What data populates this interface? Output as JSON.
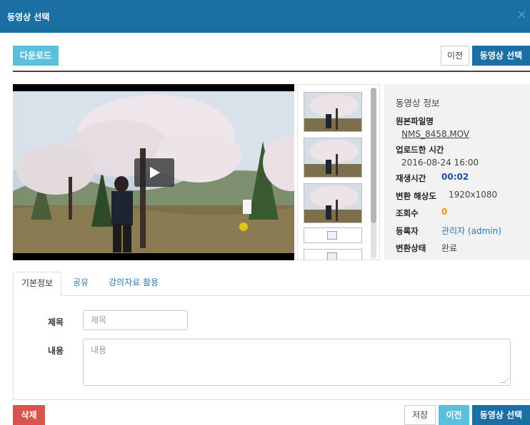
{
  "dialog": {
    "title": "동영상 선택",
    "close_symbol": "×"
  },
  "toolbar": {
    "download_label": "다운로드",
    "prev_label": "이전",
    "select_label": "동영상 선택"
  },
  "info": {
    "heading": "동영상 정보",
    "original_filename_label": "원본파일명",
    "original_filename": "NMS_8458.MOV",
    "upload_time_label": "업로드한 시간",
    "upload_time": "2016-08-24 16:00",
    "duration_label": "재생시간",
    "duration": "00:02",
    "resolution_label": "변환 해상도",
    "resolution": "1920x1080",
    "views_label": "조회수",
    "views": "0",
    "owner_label": "등록자",
    "owner": "관리자 (admin)",
    "status_label": "변환상태",
    "status": "완료"
  },
  "tabs": [
    {
      "label": "기본정보",
      "active": true
    },
    {
      "label": "공유",
      "active": false
    },
    {
      "label": "강의자료 활용",
      "active": false
    }
  ],
  "form": {
    "title_label": "제목",
    "title_placeholder": "제목",
    "content_label": "내용",
    "content_placeholder": "내용"
  },
  "footer": {
    "delete_label": "삭제",
    "save_label": "저장",
    "prev_label": "이전",
    "select_label": "동영상 선택"
  },
  "colors": {
    "header": "#1a6fa3",
    "info_button": "#5bc0de",
    "primary_button": "#1a6fa3",
    "danger_button": "#d9534f",
    "views_value": "#e8930a"
  }
}
